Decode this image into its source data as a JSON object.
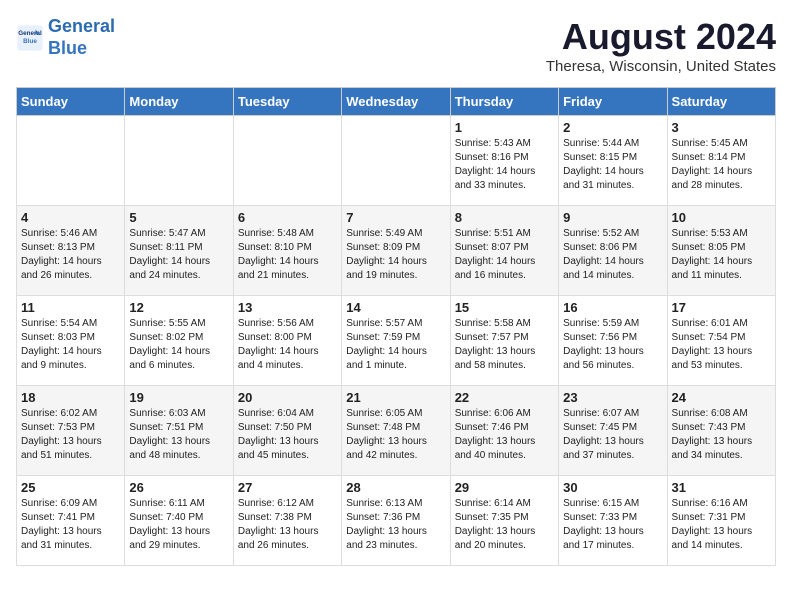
{
  "logo": {
    "line1": "General",
    "line2": "Blue"
  },
  "title": "August 2024",
  "subtitle": "Theresa, Wisconsin, United States",
  "days_header": [
    "Sunday",
    "Monday",
    "Tuesday",
    "Wednesday",
    "Thursday",
    "Friday",
    "Saturday"
  ],
  "weeks": [
    [
      {
        "day": "",
        "content": ""
      },
      {
        "day": "",
        "content": ""
      },
      {
        "day": "",
        "content": ""
      },
      {
        "day": "",
        "content": ""
      },
      {
        "day": "1",
        "content": "Sunrise: 5:43 AM\nSunset: 8:16 PM\nDaylight: 14 hours\nand 33 minutes."
      },
      {
        "day": "2",
        "content": "Sunrise: 5:44 AM\nSunset: 8:15 PM\nDaylight: 14 hours\nand 31 minutes."
      },
      {
        "day": "3",
        "content": "Sunrise: 5:45 AM\nSunset: 8:14 PM\nDaylight: 14 hours\nand 28 minutes."
      }
    ],
    [
      {
        "day": "4",
        "content": "Sunrise: 5:46 AM\nSunset: 8:13 PM\nDaylight: 14 hours\nand 26 minutes."
      },
      {
        "day": "5",
        "content": "Sunrise: 5:47 AM\nSunset: 8:11 PM\nDaylight: 14 hours\nand 24 minutes."
      },
      {
        "day": "6",
        "content": "Sunrise: 5:48 AM\nSunset: 8:10 PM\nDaylight: 14 hours\nand 21 minutes."
      },
      {
        "day": "7",
        "content": "Sunrise: 5:49 AM\nSunset: 8:09 PM\nDaylight: 14 hours\nand 19 minutes."
      },
      {
        "day": "8",
        "content": "Sunrise: 5:51 AM\nSunset: 8:07 PM\nDaylight: 14 hours\nand 16 minutes."
      },
      {
        "day": "9",
        "content": "Sunrise: 5:52 AM\nSunset: 8:06 PM\nDaylight: 14 hours\nand 14 minutes."
      },
      {
        "day": "10",
        "content": "Sunrise: 5:53 AM\nSunset: 8:05 PM\nDaylight: 14 hours\nand 11 minutes."
      }
    ],
    [
      {
        "day": "11",
        "content": "Sunrise: 5:54 AM\nSunset: 8:03 PM\nDaylight: 14 hours\nand 9 minutes."
      },
      {
        "day": "12",
        "content": "Sunrise: 5:55 AM\nSunset: 8:02 PM\nDaylight: 14 hours\nand 6 minutes."
      },
      {
        "day": "13",
        "content": "Sunrise: 5:56 AM\nSunset: 8:00 PM\nDaylight: 14 hours\nand 4 minutes."
      },
      {
        "day": "14",
        "content": "Sunrise: 5:57 AM\nSunset: 7:59 PM\nDaylight: 14 hours\nand 1 minute."
      },
      {
        "day": "15",
        "content": "Sunrise: 5:58 AM\nSunset: 7:57 PM\nDaylight: 13 hours\nand 58 minutes."
      },
      {
        "day": "16",
        "content": "Sunrise: 5:59 AM\nSunset: 7:56 PM\nDaylight: 13 hours\nand 56 minutes."
      },
      {
        "day": "17",
        "content": "Sunrise: 6:01 AM\nSunset: 7:54 PM\nDaylight: 13 hours\nand 53 minutes."
      }
    ],
    [
      {
        "day": "18",
        "content": "Sunrise: 6:02 AM\nSunset: 7:53 PM\nDaylight: 13 hours\nand 51 minutes."
      },
      {
        "day": "19",
        "content": "Sunrise: 6:03 AM\nSunset: 7:51 PM\nDaylight: 13 hours\nand 48 minutes."
      },
      {
        "day": "20",
        "content": "Sunrise: 6:04 AM\nSunset: 7:50 PM\nDaylight: 13 hours\nand 45 minutes."
      },
      {
        "day": "21",
        "content": "Sunrise: 6:05 AM\nSunset: 7:48 PM\nDaylight: 13 hours\nand 42 minutes."
      },
      {
        "day": "22",
        "content": "Sunrise: 6:06 AM\nSunset: 7:46 PM\nDaylight: 13 hours\nand 40 minutes."
      },
      {
        "day": "23",
        "content": "Sunrise: 6:07 AM\nSunset: 7:45 PM\nDaylight: 13 hours\nand 37 minutes."
      },
      {
        "day": "24",
        "content": "Sunrise: 6:08 AM\nSunset: 7:43 PM\nDaylight: 13 hours\nand 34 minutes."
      }
    ],
    [
      {
        "day": "25",
        "content": "Sunrise: 6:09 AM\nSunset: 7:41 PM\nDaylight: 13 hours\nand 31 minutes."
      },
      {
        "day": "26",
        "content": "Sunrise: 6:11 AM\nSunset: 7:40 PM\nDaylight: 13 hours\nand 29 minutes."
      },
      {
        "day": "27",
        "content": "Sunrise: 6:12 AM\nSunset: 7:38 PM\nDaylight: 13 hours\nand 26 minutes."
      },
      {
        "day": "28",
        "content": "Sunrise: 6:13 AM\nSunset: 7:36 PM\nDaylight: 13 hours\nand 23 minutes."
      },
      {
        "day": "29",
        "content": "Sunrise: 6:14 AM\nSunset: 7:35 PM\nDaylight: 13 hours\nand 20 minutes."
      },
      {
        "day": "30",
        "content": "Sunrise: 6:15 AM\nSunset: 7:33 PM\nDaylight: 13 hours\nand 17 minutes."
      },
      {
        "day": "31",
        "content": "Sunrise: 6:16 AM\nSunset: 7:31 PM\nDaylight: 13 hours\nand 14 minutes."
      }
    ]
  ]
}
